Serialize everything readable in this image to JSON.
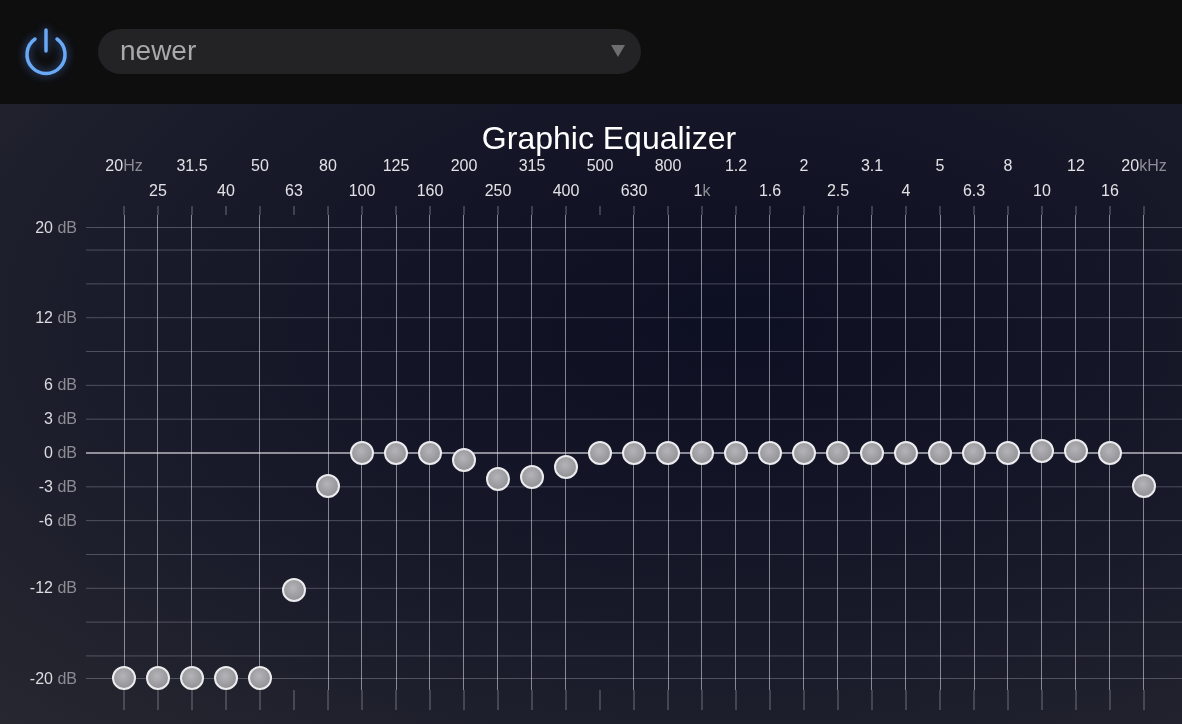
{
  "toolbar": {
    "power_on": true,
    "preset": "newer"
  },
  "title": "Graphic Equalizer",
  "db_scale": [
    {
      "value": "20",
      "unit": "dB"
    },
    {
      "value": "12",
      "unit": "dB"
    },
    {
      "value": "6",
      "unit": "dB"
    },
    {
      "value": "3",
      "unit": "dB"
    },
    {
      "value": "0",
      "unit": "dB"
    },
    {
      "value": "-3",
      "unit": "dB"
    },
    {
      "value": "-6",
      "unit": "dB"
    },
    {
      "value": "-12",
      "unit": "dB"
    },
    {
      "value": "-20",
      "unit": "dB"
    }
  ],
  "bands": [
    {
      "frequency": "20",
      "unit": "Hz",
      "level": 0
    },
    {
      "frequency": "25",
      "level": 0
    },
    {
      "frequency": "31.5",
      "level": 0
    },
    {
      "frequency": "40",
      "level": 0
    },
    {
      "frequency": "50",
      "level": 0
    },
    {
      "frequency": "63",
      "level": 0.195
    },
    {
      "frequency": "80",
      "level": 0.425
    },
    {
      "frequency": "100",
      "level": 0.5
    },
    {
      "frequency": "125",
      "level": 0.5
    },
    {
      "frequency": "160",
      "level": 0.5
    },
    {
      "frequency": "200",
      "level": 0.484
    },
    {
      "frequency": "250",
      "level": 0.441
    },
    {
      "frequency": "315",
      "level": 0.446
    },
    {
      "frequency": "400",
      "level": 0.468
    },
    {
      "frequency": "500",
      "level": 0.5
    },
    {
      "frequency": "630",
      "level": 0.5
    },
    {
      "frequency": "800",
      "level": 0.5
    },
    {
      "frequency": "1",
      "unit": "k",
      "level": 0.5
    },
    {
      "frequency": "1.2",
      "level": 0.5
    },
    {
      "frequency": "1.6",
      "level": 0.5
    },
    {
      "frequency": "2",
      "level": 0.5
    },
    {
      "frequency": "2.5",
      "level": 0.5
    },
    {
      "frequency": "3.1",
      "level": 0.5
    },
    {
      "frequency": "4",
      "level": 0.5
    },
    {
      "frequency": "5",
      "level": 0.5
    },
    {
      "frequency": "6.3",
      "level": 0.5
    },
    {
      "frequency": "8",
      "level": 0.5
    },
    {
      "frequency": "10",
      "level": 0.504
    },
    {
      "frequency": "12",
      "level": 0.504
    },
    {
      "frequency": "16",
      "level": 0.5
    },
    {
      "frequency": "20",
      "unit": "kHz",
      "level": 0.425
    }
  ]
}
